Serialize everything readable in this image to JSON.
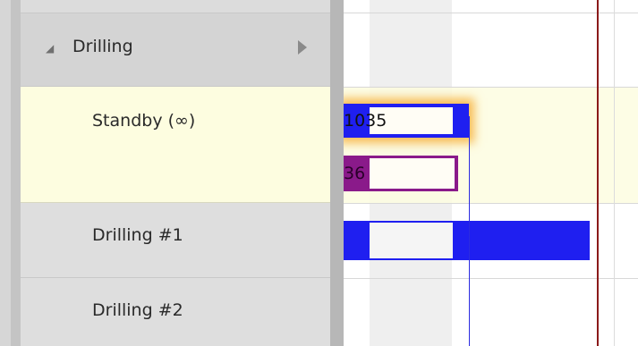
{
  "tree": {
    "group": {
      "expand_glyph": "◢",
      "label": "Drilling"
    },
    "rows": [
      {
        "label": "Standby (∞)"
      },
      {
        "label": "Drilling #1"
      },
      {
        "label": "Drilling #2"
      }
    ]
  },
  "timeline": {
    "standby_top_bar_label": "1035",
    "standby_bottom_bar_label": "36"
  },
  "colors": {
    "bar_blue": "#1f1ff0",
    "bar_purple": "#8a1a8a",
    "now_line": "#8b1a1a",
    "highlight_row": "#fdfde0",
    "glow": "#f5a623"
  }
}
